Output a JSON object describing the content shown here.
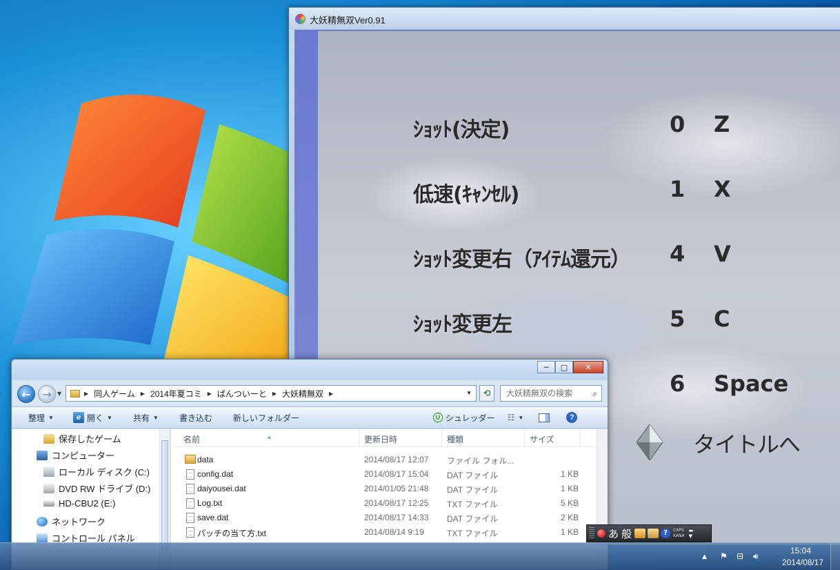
{
  "game": {
    "title": "大妖精無双Ver0.91",
    "menu": [
      {
        "label": "ｼｮｯﾄ(決定)",
        "pad": "0",
        "key": "Z"
      },
      {
        "label": "低速(ｷｬﾝｾﾙ)",
        "pad": "1",
        "key": "X"
      },
      {
        "label": "ｼｮｯﾄ変更右（ｱｲﾃﾑ還元）",
        "pad": "4",
        "key": "V"
      },
      {
        "label": "ｼｮｯﾄ変更左",
        "pad": "5",
        "key": "C"
      },
      {
        "label": "",
        "pad": "6",
        "key": "Space"
      }
    ],
    "back_label": "タイトルへ"
  },
  "explorer": {
    "caption_buttons": {
      "minimize": "─",
      "maximize": "□",
      "close": "✕"
    },
    "breadcrumb": [
      "同人ゲーム",
      "2014年夏コミ",
      "ぱんついーと",
      "大妖精無双"
    ],
    "search_placeholder": "大妖精無双の検索",
    "toolbar": {
      "organize": "整理",
      "open": "開く",
      "share": "共有",
      "burn": "書き込む",
      "new_folder": "新しいフォルダー",
      "shredder": "シュレッダー"
    },
    "nav_items": [
      {
        "label": "保存したゲーム",
        "icon": "saved-games-icon"
      },
      {
        "label": "コンピューター",
        "icon": "computer-icon"
      },
      {
        "label": "ローカル ディスク (C:)",
        "icon": "drive-icon"
      },
      {
        "label": "DVD RW ドライブ (D:)",
        "icon": "dvd-drive-icon"
      },
      {
        "label": "HD-CBU2 (E:)",
        "icon": "external-drive-icon"
      },
      {
        "label": "ネットワーク",
        "icon": "network-icon"
      },
      {
        "label": "コントロール パネル",
        "icon": "control-panel-icon"
      }
    ],
    "columns": {
      "name": "名前",
      "date": "更新日時",
      "type": "種類",
      "size": "サイズ"
    },
    "files": [
      {
        "name": "data",
        "date": "2014/08/17 12:07",
        "type": "ファイル フォル...",
        "size": "",
        "kind": "folder"
      },
      {
        "name": "config.dat",
        "date": "2014/08/17 15:04",
        "type": "DAT ファイル",
        "size": "1 KB",
        "kind": "file"
      },
      {
        "name": "daiyousei.dat",
        "date": "2014/01/05 21:48",
        "type": "DAT ファイル",
        "size": "1 KB",
        "kind": "file"
      },
      {
        "name": "Log.txt",
        "date": "2014/08/17 12:25",
        "type": "TXT ファイル",
        "size": "5 KB",
        "kind": "file"
      },
      {
        "name": "save.dat",
        "date": "2014/08/17 14:33",
        "type": "DAT ファイル",
        "size": "2 KB",
        "kind": "file"
      },
      {
        "name": "パッチの当て方.txt",
        "date": "2014/08/14 9:19",
        "type": "TXT ファイル",
        "size": "1 KB",
        "kind": "file"
      }
    ]
  },
  "ime": {
    "mode": "あ",
    "dict": "般",
    "caps": "CAPS",
    "kana": "KANA"
  },
  "taskbar": {
    "time": "15:04",
    "date": "2014/08/17"
  }
}
